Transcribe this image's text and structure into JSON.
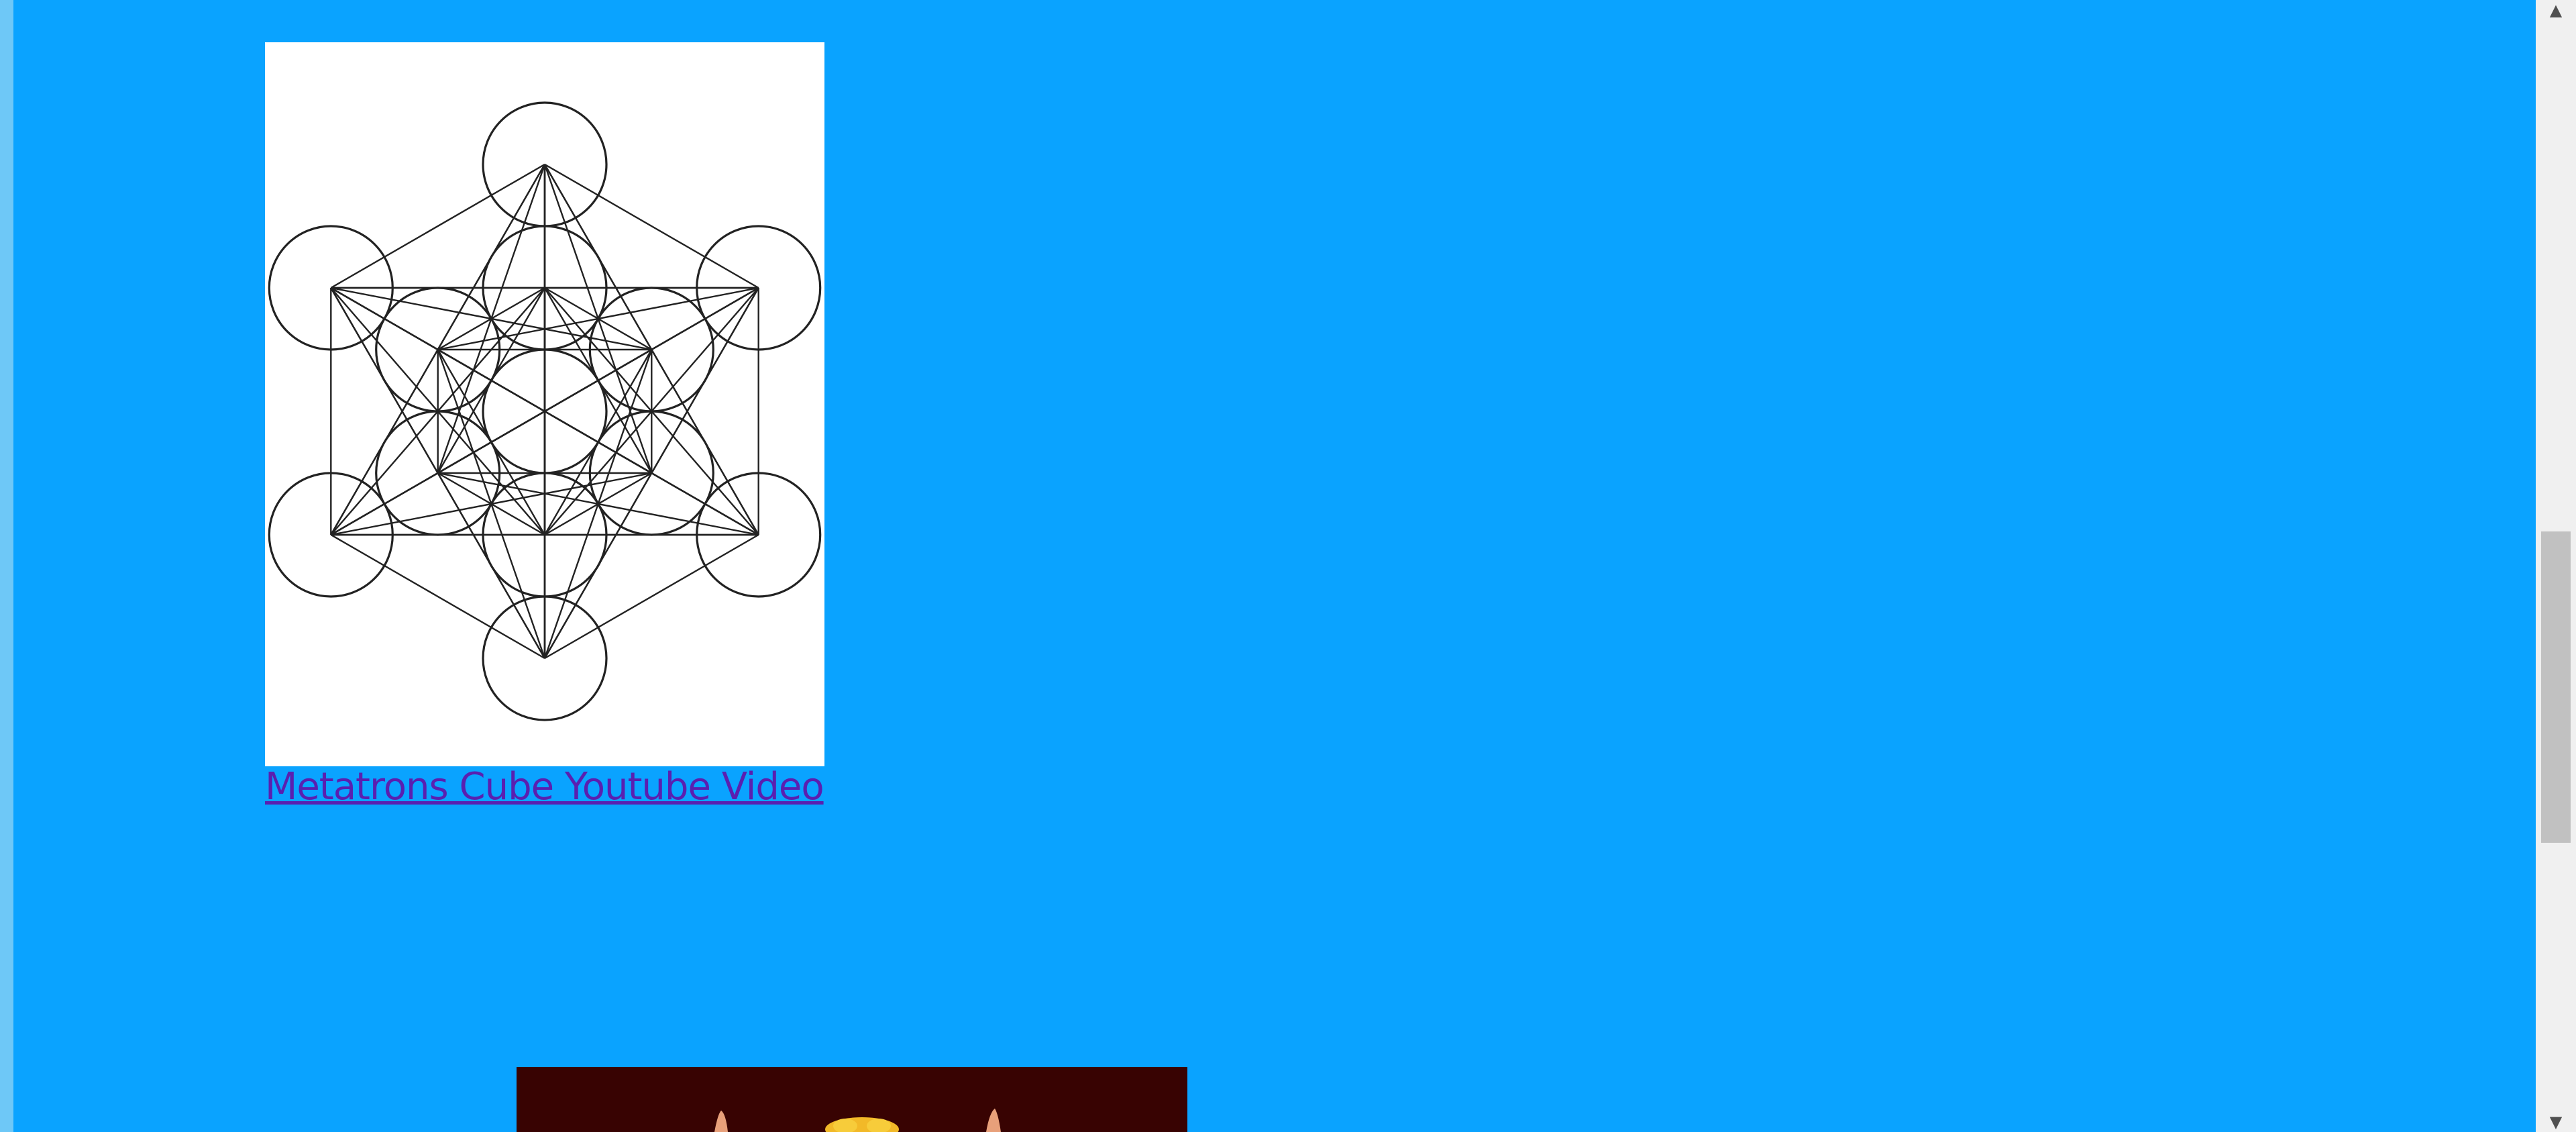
{
  "link": {
    "label": "Metatrons  Cube Youtube Video"
  },
  "images": {
    "metatron": {
      "icon": "metatrons-cube-icon"
    },
    "second": {
      "icon": "partial-illustration-icon"
    }
  },
  "colors": {
    "page_background": "#0aa3ff",
    "link": "#5a1fb0",
    "image_border": "#222222",
    "second_image_bg": "#380302"
  },
  "scrollbar": {
    "up_icon": "scroll-up-arrow-icon",
    "down_icon": "scroll-down-arrow-icon"
  }
}
